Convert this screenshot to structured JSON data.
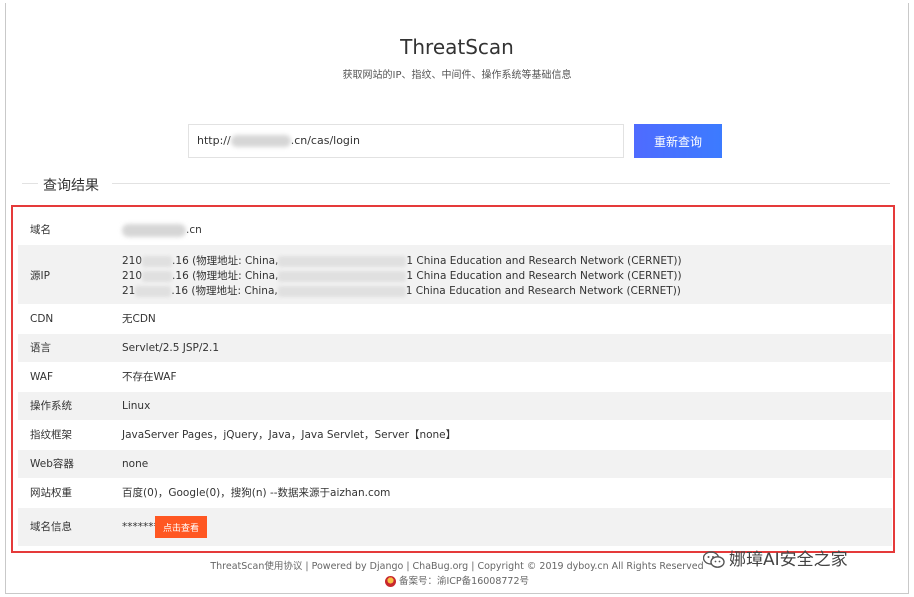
{
  "header": {
    "title": "ThreatScan",
    "subtitle": "获取网站的IP、指纹、中间件、操作系统等基础信息"
  },
  "query": {
    "input_prefix": "http://",
    "input_suffix": ".cn/cas/login",
    "button_label": "重新查询"
  },
  "results": {
    "legend": "查询结果",
    "domain_label": "域名",
    "domain_suffix": ".cn",
    "ip_label": "源IP",
    "ip_lines": [
      {
        "prefix": "210",
        "mid": ".16 (物理地址: China,",
        "suffix": "1 China Education and Research Network (CERNET))"
      },
      {
        "prefix": "210",
        "mid": ".16 (物理地址: China,",
        "suffix": "1 China Education and Research Network (CERNET))"
      },
      {
        "prefix": "21",
        "mid": ".16 (物理地址: China,",
        "suffix": "1 China Education and Research Network (CERNET))"
      }
    ],
    "cdn_label": "CDN",
    "cdn_value": "无CDN",
    "lang_label": "语言",
    "lang_value": "Servlet/2.5 JSP/2.1",
    "waf_label": "WAF",
    "waf_value": "不存在WAF",
    "os_label": "操作系统",
    "os_value": "Linux",
    "fp_label": "指纹框架",
    "fp_value": "JavaServer Pages，jQuery，Java，Java Servlet，Server【none】",
    "web_label": "Web容器",
    "web_value": "none",
    "weight_label": "网站权重",
    "weight_value": "百度(0)，Google(0)，搜狗(n) --数据来源于aizhan.com",
    "whois_label": "域名信息",
    "whois_value": "*******",
    "whois_button": "点击查看"
  },
  "footer": {
    "line": "ThreatScan使用协议 | Powered by Django | ChaBug.org | Copyright © 2019 dyboy.cn All Rights Reserved",
    "icp": "备案号：渝ICP备16008772号"
  },
  "watermark": {
    "text": "娜璋AI安全之家"
  }
}
